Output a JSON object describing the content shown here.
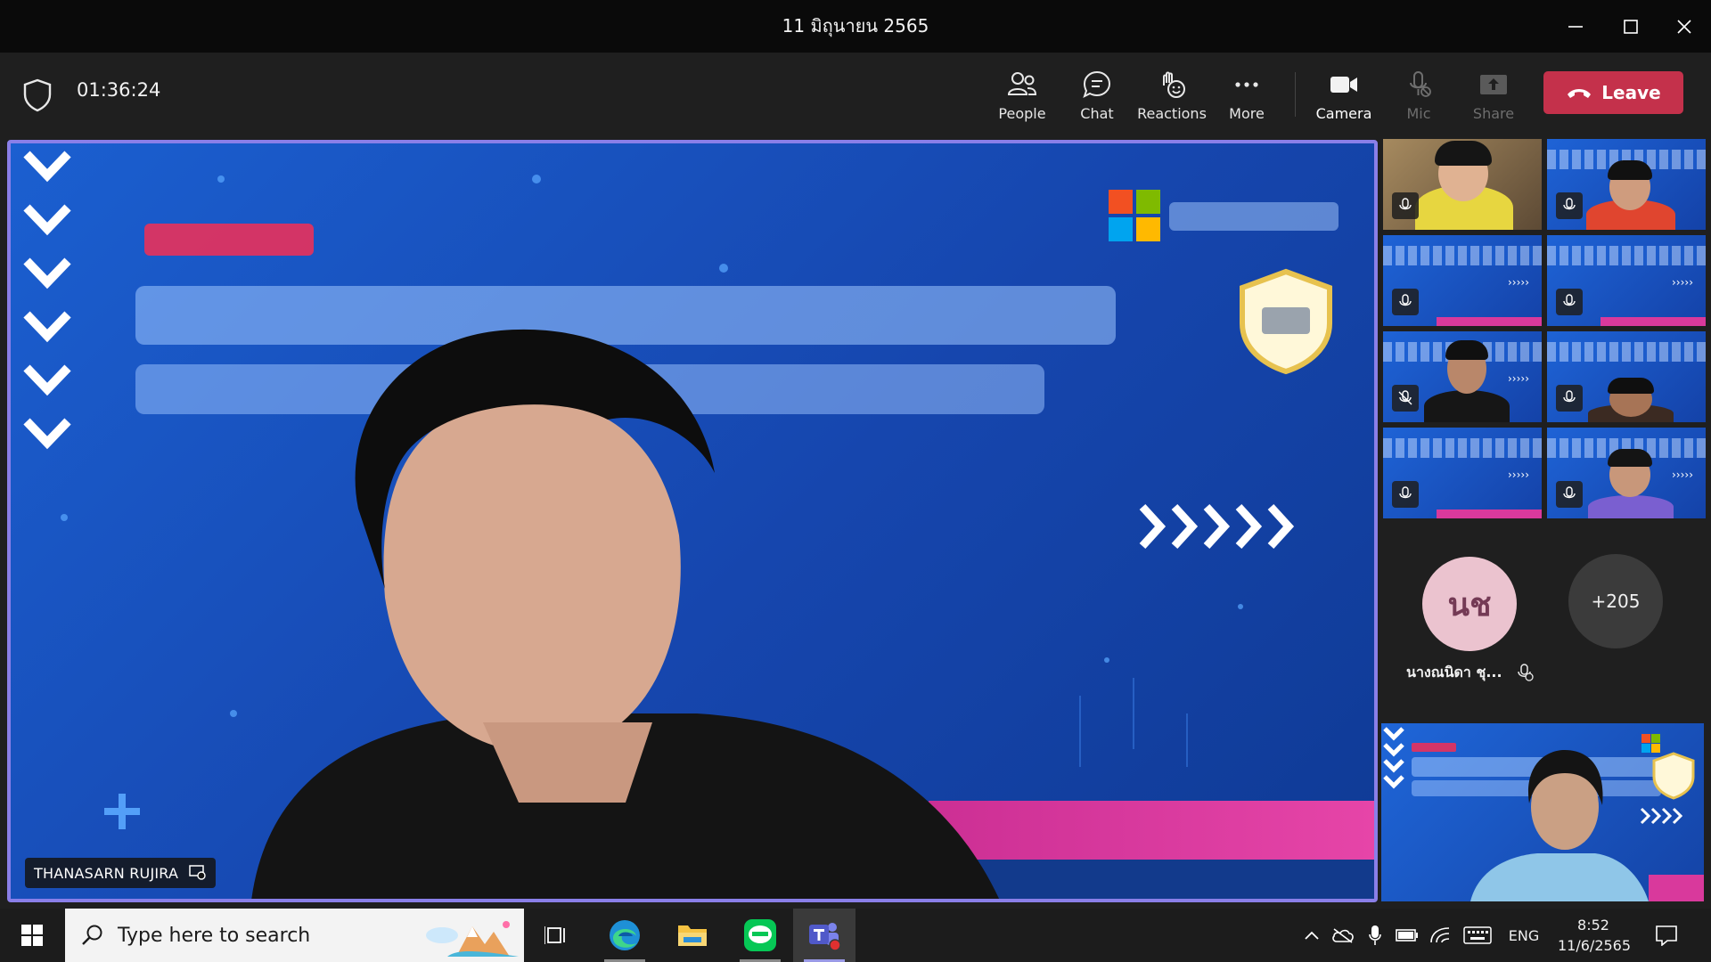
{
  "window": {
    "title": "11 มิถุนายน 2565"
  },
  "toolbar": {
    "timer": "01:36:24",
    "buttons": [
      {
        "label": "People",
        "icon": "people-icon"
      },
      {
        "label": "Chat",
        "icon": "chat-icon"
      },
      {
        "label": "Reactions",
        "icon": "reactions-icon"
      },
      {
        "label": "More",
        "icon": "more-icon"
      },
      {
        "label": "Camera",
        "icon": "camera-icon"
      },
      {
        "label": "Mic",
        "icon": "mic-off-icon"
      },
      {
        "label": "Share",
        "icon": "share-icon"
      }
    ],
    "leave_label": "Leave"
  },
  "stage": {
    "speaker_name": "THANASARN RUJIRA"
  },
  "rail": {
    "avatar_initials": "นช",
    "avatar_name": "นางณนิดา ชุ...",
    "more_count": "+205"
  },
  "taskbar": {
    "search_placeholder": "Type here to search",
    "language": "ENG",
    "time": "8:52",
    "date": "11/6/2565"
  },
  "colors": {
    "accent_border": "#8a7fe8",
    "leave_red": "#c4314b",
    "slide_blue": "#1b5fd0"
  }
}
